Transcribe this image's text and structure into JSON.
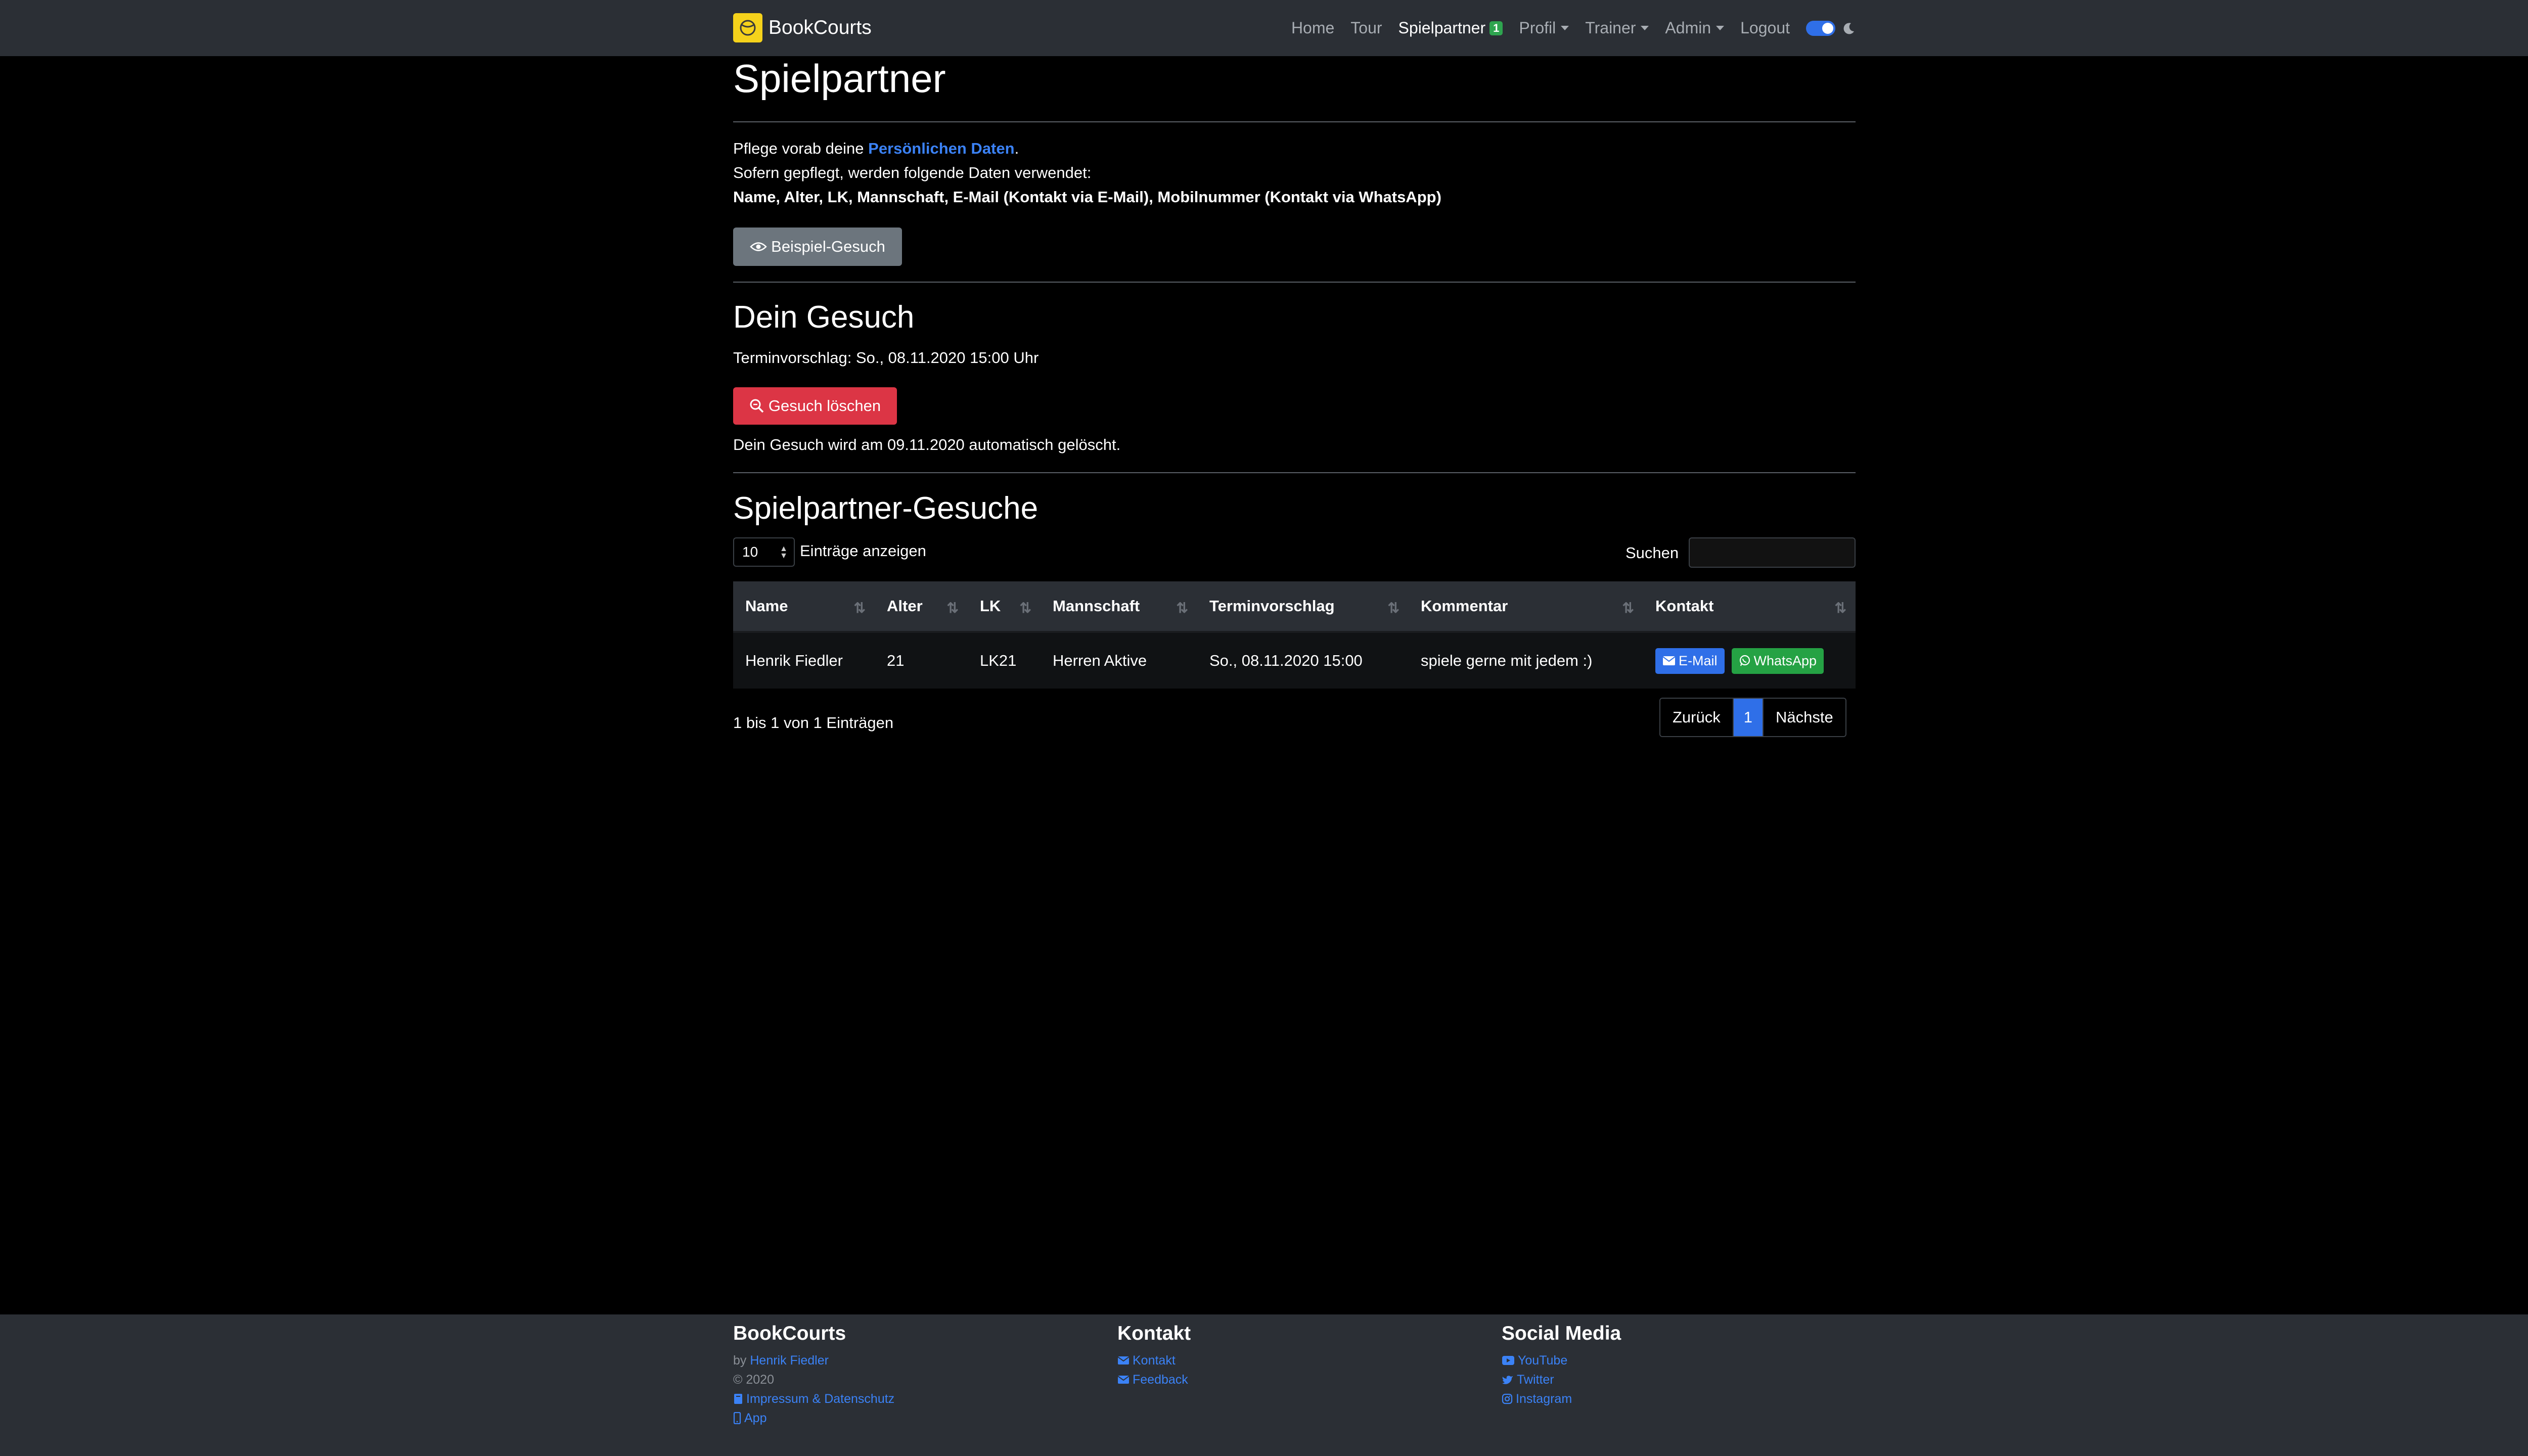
{
  "navbar": {
    "brand": "BookCourts",
    "items": {
      "home": "Home",
      "tour": "Tour",
      "spielpartner": "Spielpartner",
      "spielpartner_badge": "1",
      "profil": "Profil",
      "trainer": "Trainer",
      "admin": "Admin",
      "logout": "Logout"
    }
  },
  "page": {
    "title": "Spielpartner",
    "intro_prefix": "Pflege vorab deine ",
    "intro_link": "Persönlichen Daten",
    "intro_suffix": ".",
    "intro_line2": "Sofern gepflegt, werden folgende Daten verwendet:",
    "intro_line3": "Name, Alter, LK, Mannschaft, E-Mail (Kontakt via E-Mail), Mobilnummer (Kontakt via WhatsApp)",
    "example_button": "Beispiel-Gesuch"
  },
  "my_request": {
    "title": "Dein Gesuch",
    "proposal": "Terminvorschlag: So., 08.11.2020 15:00 Uhr",
    "delete_button": "Gesuch löschen",
    "auto_delete_note": "Dein Gesuch wird am 09.11.2020 automatisch gelöscht."
  },
  "requests": {
    "title": "Spielpartner-Gesuche",
    "length_value": "10",
    "length_label": "Einträge anzeigen",
    "search_label": "Suchen",
    "columns": [
      "Name",
      "Alter",
      "LK",
      "Mannschaft",
      "Terminvorschlag",
      "Kommentar",
      "Kontakt"
    ],
    "rows": [
      {
        "name": "Henrik Fiedler",
        "alter": "21",
        "lk": "LK21",
        "mannschaft": "Herren Aktive",
        "termin": "So., 08.11.2020 15:00",
        "kommentar": "spiele gerne mit jedem :)",
        "email_label": "E-Mail",
        "whatsapp_label": "WhatsApp"
      }
    ],
    "info": "1 bis 1 von 1 Einträgen",
    "pagination": {
      "prev": "Zurück",
      "current": "1",
      "next": "Nächste"
    }
  },
  "footer": {
    "col1": {
      "title": "BookCourts",
      "by_prefix": "by ",
      "by_name": "Henrik Fiedler",
      "copyright": "© 2020",
      "impressum": "Impressum & Datenschutz",
      "app": "App"
    },
    "col2": {
      "title": "Kontakt",
      "kontakt": "Kontakt",
      "feedback": "Feedback"
    },
    "col3": {
      "title": "Social Media",
      "youtube": "YouTube",
      "twitter": "Twitter",
      "instagram": "Instagram"
    }
  },
  "colors": {
    "accent": "#3b82f6",
    "danger": "#dc3545",
    "success": "#25a244",
    "brand": "#f5d21b"
  }
}
